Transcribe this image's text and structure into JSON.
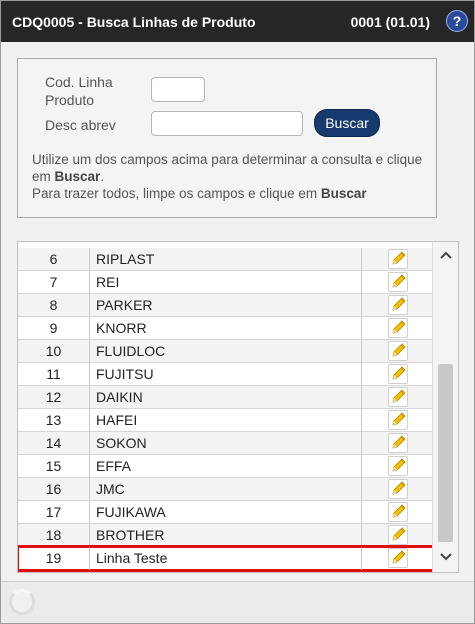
{
  "header": {
    "title": "CDQ0005 - Busca Linhas de Produto",
    "code": "0001 (01.01)",
    "help_label": "?"
  },
  "filter": {
    "cod_label": "Cod. Linha Produto",
    "cod_value": "",
    "desc_label": "Desc abrev",
    "desc_value": "",
    "button_label": "Buscar",
    "help_line1": "Utilize um dos campos acima para determinar a consulta e clique em",
    "help_bold1": "Buscar",
    "help_line2": "Para trazer todos, limpe os campos e clique em",
    "help_bold2": "Buscar"
  },
  "table": {
    "rows": [
      {
        "num": "6",
        "name": "RIPLAST"
      },
      {
        "num": "7",
        "name": "REI"
      },
      {
        "num": "8",
        "name": "PARKER"
      },
      {
        "num": "9",
        "name": "KNORR"
      },
      {
        "num": "10",
        "name": "FLUIDLOC"
      },
      {
        "num": "11",
        "name": "FUJITSU"
      },
      {
        "num": "12",
        "name": "DAIKIN"
      },
      {
        "num": "13",
        "name": "HAFEI"
      },
      {
        "num": "14",
        "name": "SOKON"
      },
      {
        "num": "15",
        "name": "EFFA"
      },
      {
        "num": "16",
        "name": "JMC"
      },
      {
        "num": "17",
        "name": "FUJIKAWA"
      },
      {
        "num": "18",
        "name": "BROTHER"
      },
      {
        "num": "19",
        "name": "Linha Teste"
      }
    ],
    "selected_row": "19"
  },
  "colors": {
    "titlebar": "#262626",
    "button": "#163a6e",
    "highlight": "#e01010",
    "pencil": "#f2c200"
  },
  "icons": {
    "edit": "pencil-icon",
    "help": "help-icon",
    "scroll_up": "chevron-up-icon",
    "scroll_down": "chevron-down-icon",
    "loading": "spinner-icon"
  }
}
